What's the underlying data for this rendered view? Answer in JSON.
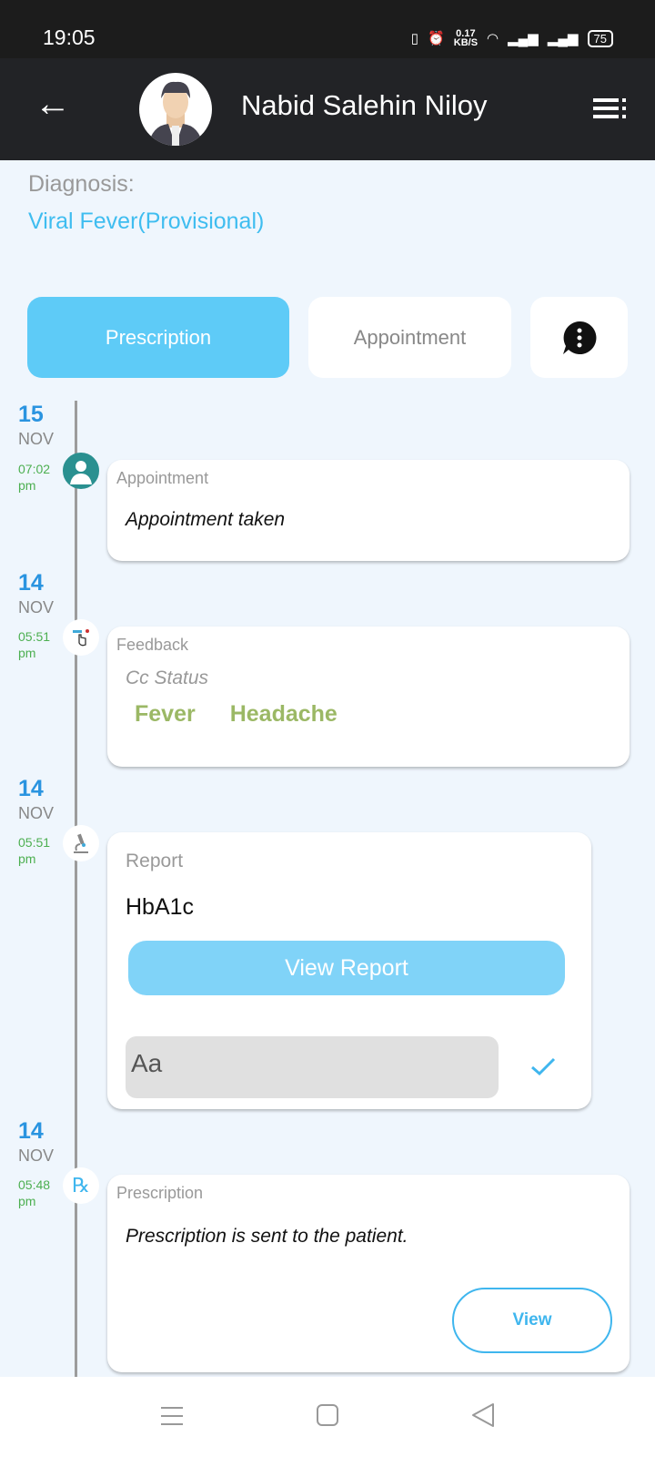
{
  "status": {
    "time": "19:05",
    "net_speed": "0.17",
    "net_unit": "KB/S",
    "battery": "75"
  },
  "header": {
    "title": "Nabid Salehin Niloy"
  },
  "diagnosis": {
    "label": "Diagnosis:",
    "value": "Viral Fever(Provisional)"
  },
  "tabs": [
    {
      "label": "Prescription",
      "active": true
    },
    {
      "label": "Appointment",
      "active": false
    }
  ],
  "timeline": [
    {
      "day": "15",
      "month": "NOV",
      "time": "07:02",
      "ampm": "pm",
      "type": "Appointment",
      "text": "Appointment taken"
    },
    {
      "day": "14",
      "month": "NOV",
      "time": "05:51",
      "ampm": "pm",
      "type": "Feedback",
      "subtitle": "Cc Status",
      "tags": [
        "Fever",
        "Headache"
      ]
    },
    {
      "day": "14",
      "month": "NOV",
      "time": "05:51",
      "ampm": "pm",
      "type": "Report",
      "test": "HbA1c",
      "button": "View Report",
      "input_placeholder": "Aa"
    },
    {
      "day": "14",
      "month": "NOV",
      "time": "05:48",
      "ampm": "pm",
      "type": "Prescription",
      "text": "Prescription is sent to the patient.",
      "button": "View"
    }
  ],
  "colors": {
    "accent": "#5ecbf7",
    "date": "#2a94e0",
    "time": "#4caf50",
    "tag": "#9bb865"
  }
}
